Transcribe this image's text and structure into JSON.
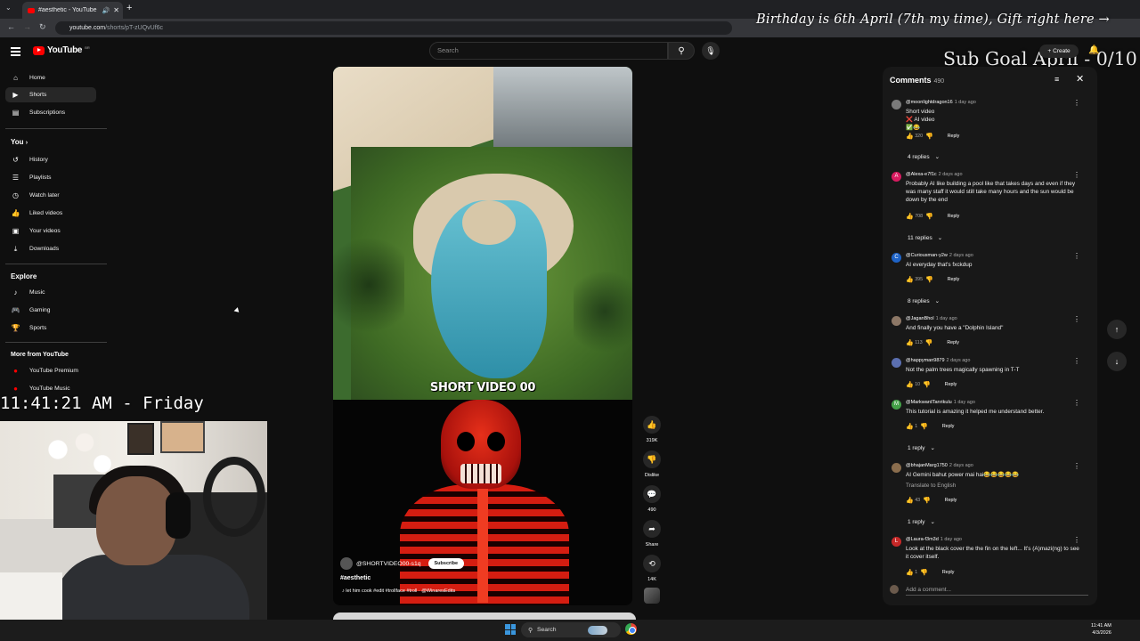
{
  "browser": {
    "tab_title": "#aesthetic - YouTube",
    "url_host": "youtube.com",
    "url_path": "/shorts/pT-zUQvUf6c"
  },
  "stream_overlay": {
    "title": "Birthday is 6th April (7th my time), Gift right here",
    "arrow": "→",
    "sub_goal": "Sub Goal April - 0/10",
    "clock": "11:41:21 AM - Friday"
  },
  "header": {
    "logo_text": "YouTube",
    "region": "BR",
    "search_placeholder": "Search",
    "create_label": "Create"
  },
  "sidebar": {
    "main": [
      {
        "label": "Home",
        "icon": "home-icon"
      },
      {
        "label": "Shorts",
        "icon": "shorts-icon",
        "active": true
      },
      {
        "label": "Subscriptions",
        "icon": "subscriptions-icon"
      }
    ],
    "you_heading": "You",
    "you_items": [
      {
        "label": "History"
      },
      {
        "label": "Playlists"
      },
      {
        "label": "Watch later"
      },
      {
        "label": "Liked videos"
      },
      {
        "label": "Your videos"
      },
      {
        "label": "Downloads"
      }
    ],
    "explore_heading": "Explore",
    "explore_items": [
      {
        "label": "Music"
      },
      {
        "label": "Gaming"
      },
      {
        "label": "Sports"
      }
    ],
    "more_heading": "More from YouTube",
    "more_items": [
      {
        "label": "YouTube Premium"
      },
      {
        "label": "YouTube Music"
      }
    ]
  },
  "video": {
    "caption": "SHORT VIDEO 00",
    "channel": "@SHORTVIDEO00-s1q",
    "subscribe_label": "Subscribe",
    "title": "#aesthetic",
    "sound": "♪ let him cook #edit #trollface #troll · @WinaresEdits"
  },
  "actions": {
    "likes": "319K",
    "dislike": "Dislike",
    "comments": "490",
    "share": "Share",
    "remix": "14K"
  },
  "comments_panel": {
    "title": "Comments",
    "count": "490",
    "add_placeholder": "Add a comment...",
    "reply_label": "Reply",
    "comments": [
      {
        "user": "@moonlightdragon16",
        "time": "1 day ago",
        "text": "Short video ❌ AI video ✅😂",
        "likes": "320",
        "replies": "4 replies",
        "avatar_color": "#7a7a7a",
        "initial": ""
      },
      {
        "user": "@Alexa-e7f1c",
        "time": "2 days ago",
        "text": "Probably AI like building a pool like that takes days and even if they was many staff it would still take many hours and the sun would be down by the end",
        "likes": "708",
        "replies": "11 replies",
        "avatar_color": "#d81b60",
        "initial": "A"
      },
      {
        "user": "@Curiousman-y2w",
        "time": "2 days ago",
        "text": "AI everyday that's fxckdup",
        "likes": "395",
        "replies": "8 replies",
        "avatar_color": "#1e63c7",
        "initial": "C"
      },
      {
        "user": "@JaganBhol",
        "time": "1 day ago",
        "text": "And finally you have a \"Dolphin Island\"",
        "likes": "113",
        "replies": "",
        "avatar_color": "#8c7766",
        "initial": ""
      },
      {
        "user": "@happyman9879",
        "time": "2 days ago",
        "text": "Not the palm trees magically spawning in T-T",
        "likes": "10",
        "replies": "",
        "avatar_color": "#5b6fb0",
        "initial": ""
      },
      {
        "user": "@MarkwardTanrikulu",
        "time": "1 day ago",
        "text": "This tutorial is amazing it helped me understand better.",
        "likes": "1",
        "replies": "1 reply",
        "avatar_color": "#43a047",
        "initial": "M"
      },
      {
        "user": "@bhajanMarg1750",
        "time": "2 days ago",
        "text": "AI Gemini bahut power mai hai😂😂😂😂😂",
        "translate": "Translate to English",
        "likes": "43",
        "replies": "1 reply",
        "avatar_color": "#8a6d4d",
        "initial": ""
      },
      {
        "user": "@Laura-f3m3d",
        "time": "1 day ago",
        "text": "Look at the black cover the the fin on the left... It's (A)mazi(ng) to see it cover itself.",
        "likes": "1",
        "replies": "",
        "avatar_color": "#c62828",
        "initial": "L"
      }
    ]
  },
  "taskbar": {
    "search_label": "Search",
    "time": "11:41 AM",
    "date": "4/3/2026"
  }
}
